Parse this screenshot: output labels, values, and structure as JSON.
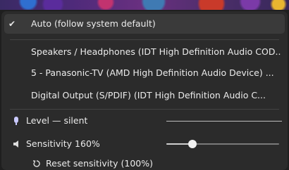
{
  "menu": {
    "auto_label": "Auto (follow system default)",
    "check_mark": "✔",
    "devices": [
      {
        "label": "Speakers / Headphones (IDT High Definition Audio COD..."
      },
      {
        "label": "5 - Panasonic-TV (AMD High Definition Audio Device) ..."
      },
      {
        "label": "Digital Output (S/PDIF) (IDT High Definition Audio C..."
      }
    ],
    "level": {
      "label": "Level — silent",
      "icon": "microphone-icon"
    },
    "sensitivity": {
      "label": "Sensitivity 160%",
      "icon": "speaker-icon",
      "slider_fraction": 0.23
    },
    "reset": {
      "label": "Reset sensitivity (100%)",
      "icon": "reset-icon"
    }
  }
}
